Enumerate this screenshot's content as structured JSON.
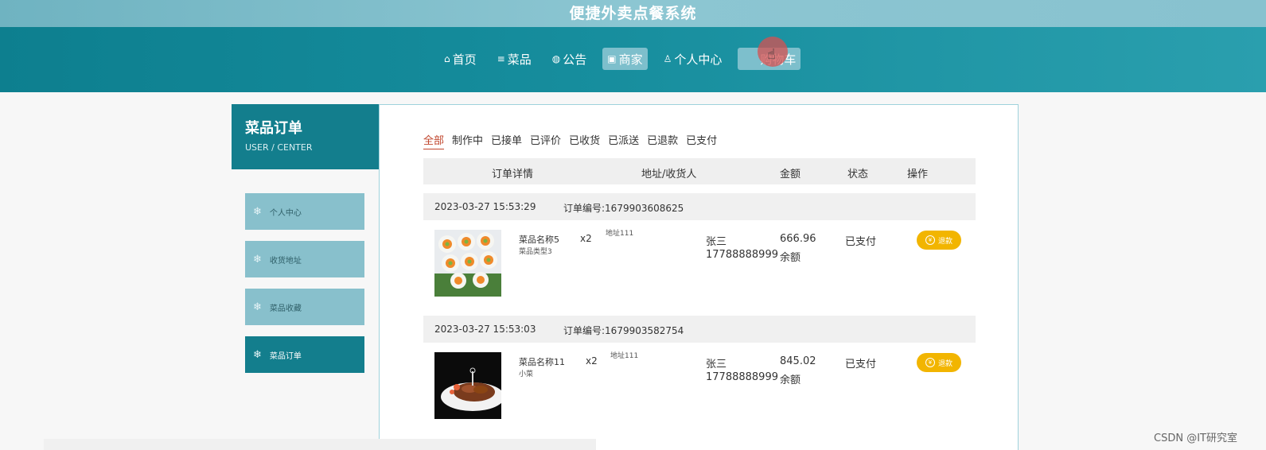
{
  "header": {
    "title": "便捷外卖点餐系统"
  },
  "nav": [
    {
      "icon": "home-icon",
      "glyph": "⌂",
      "label": "首页"
    },
    {
      "icon": "sliders-icon",
      "glyph": "≡",
      "label": "菜品"
    },
    {
      "icon": "globe-icon",
      "glyph": "◍",
      "label": "公告"
    },
    {
      "icon": "shop-icon",
      "glyph": "▣",
      "label": "商家"
    },
    {
      "icon": "user-icon",
      "glyph": "♙",
      "label": "个人中心"
    },
    {
      "icon": "cart-icon",
      "glyph": "",
      "label": "购物车"
    }
  ],
  "sidebar": {
    "title": "菜品订单",
    "subtitle": "USER / CENTER",
    "items": [
      {
        "label": "个人中心"
      },
      {
        "label": "收货地址"
      },
      {
        "label": "菜品收藏"
      },
      {
        "label": "菜品订单"
      }
    ]
  },
  "tabs": [
    "全部",
    "制作中",
    "已接单",
    "已评价",
    "已收货",
    "已派送",
    "已退款",
    "已支付"
  ],
  "table_headers": [
    "订单详情",
    "地址/收货人",
    "金额",
    "状态",
    "操作"
  ],
  "orders": [
    {
      "time": "2023-03-27 15:53:29",
      "order_no": "订单编号:1679903608625",
      "dish_name": "菜品名称5",
      "dish_type": "菜品类型3",
      "qty": "x2",
      "address": "地址111",
      "receiver": "张三",
      "phone": "17788888999",
      "amount": "666.96",
      "pay_method": "余额",
      "status": "已支付",
      "action": "退款"
    },
    {
      "time": "2023-03-27 15:53:03",
      "order_no": "订单编号:1679903582754",
      "dish_name": "菜品名称11",
      "dish_type": "小菜",
      "qty": "x2",
      "address": "地址111",
      "receiver": "张三",
      "phone": "17788888999",
      "amount": "845.02",
      "pay_method": "余额",
      "status": "已支付",
      "action": "退款"
    }
  ],
  "watermark": "CSDN @IT研究室",
  "colors": {
    "nav_band": "#168d9d",
    "accent": "#c0442b",
    "refund": "#f2b500",
    "sidebar_active": "#137e8d"
  }
}
